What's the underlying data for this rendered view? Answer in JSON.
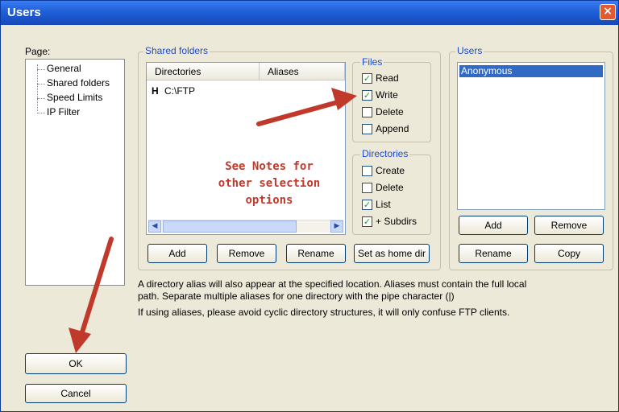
{
  "window": {
    "title": "Users",
    "close_glyph": "×"
  },
  "page_panel": {
    "label": "Page:",
    "items": [
      "General",
      "Shared folders",
      "Speed Limits",
      "IP Filter"
    ],
    "selected": "Shared folders"
  },
  "shared_folders": {
    "group_label": "Shared folders",
    "columns": [
      "Directories",
      "Aliases"
    ],
    "rows": [
      {
        "home_marker": "H",
        "directory": "C:\\FTP",
        "alias": ""
      }
    ],
    "buttons": [
      "Add",
      "Remove",
      "Rename",
      "Set as home dir"
    ]
  },
  "files": {
    "group_label": "Files",
    "options": [
      {
        "label": "Read",
        "checked": true
      },
      {
        "label": "Write",
        "checked": true
      },
      {
        "label": "Delete",
        "checked": false
      },
      {
        "label": "Append",
        "checked": false
      }
    ]
  },
  "directories": {
    "group_label": "Directories",
    "options": [
      {
        "label": "Create",
        "checked": false
      },
      {
        "label": "Delete",
        "checked": false
      },
      {
        "label": "List",
        "checked": true
      },
      {
        "label": "+ Subdirs",
        "checked": true
      }
    ]
  },
  "users": {
    "group_label": "Users",
    "list": [
      "Anonymous"
    ],
    "selected": "Anonymous",
    "buttons": [
      "Add",
      "Remove",
      "Rename",
      "Copy"
    ]
  },
  "annotation": {
    "lines": [
      "See Notes for",
      "other selection",
      "options"
    ],
    "arrow_color": "#c0392b"
  },
  "info": {
    "line1": "A directory alias will also appear at the specified location. Aliases must contain the full local",
    "line2": "path. Separate multiple aliases for one directory with the pipe character (|)",
    "line3": "If using aliases, please avoid cyclic directory structures, it will only confuse FTP clients."
  },
  "dialog_buttons": {
    "ok": "OK",
    "cancel": "Cancel"
  },
  "colors": {
    "titlebar": "#1f5fd8",
    "dialog_bg": "#ece9d8",
    "group_title": "#1b4bd3",
    "selection": "#316ac5"
  }
}
